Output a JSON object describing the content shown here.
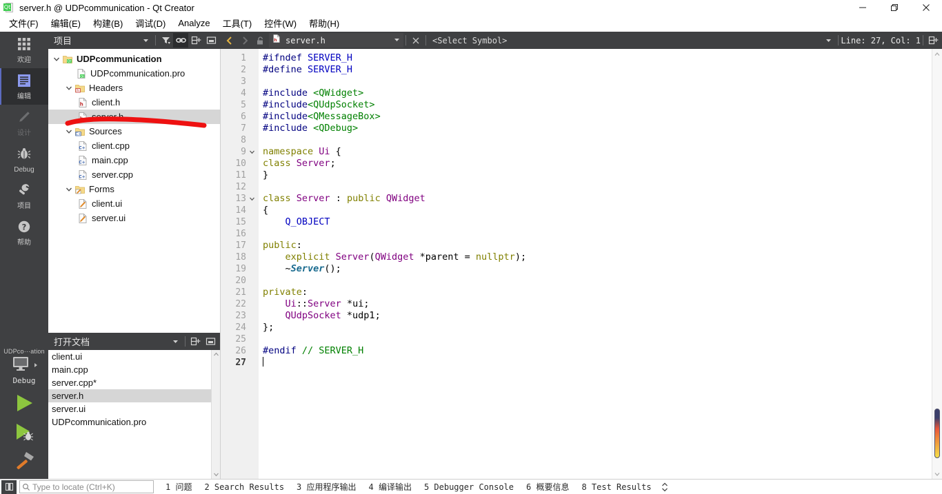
{
  "window": {
    "title": "server.h @ UDPcommunication - Qt Creator",
    "app_icon": "qt-creator-icon",
    "minimize": "minimize-icon",
    "maximize": "restore-icon",
    "close": "close-icon"
  },
  "menubar": {
    "items": [
      {
        "label": "文件(F)",
        "accel": "F"
      },
      {
        "label": "编辑(E)",
        "accel": "E"
      },
      {
        "label": "构建(B)",
        "accel": "B"
      },
      {
        "label": "调试(D)",
        "accel": "D"
      },
      {
        "label": "Analyze",
        "accel": "A"
      },
      {
        "label": "工具(T)",
        "accel": "T"
      },
      {
        "label": "控件(W)",
        "accel": "W"
      },
      {
        "label": "帮助(H)",
        "accel": "H"
      }
    ]
  },
  "modebar": {
    "modes": [
      {
        "label": "欢迎",
        "icon": "grid-icon",
        "state": "normal"
      },
      {
        "label": "编辑",
        "icon": "edit-lines-icon",
        "state": "selected"
      },
      {
        "label": "设计",
        "icon": "pencil-icon",
        "state": "disabled"
      },
      {
        "label": "Debug",
        "icon": "bug-icon",
        "state": "normal"
      },
      {
        "label": "项目",
        "icon": "wrench-icon",
        "state": "normal"
      },
      {
        "label": "帮助",
        "icon": "question-mark-icon",
        "state": "normal"
      }
    ],
    "kit": {
      "project_name": "UDPco···ation",
      "build_config": "Debug",
      "target_icon": "desktop-icon",
      "arrow_icon": "chevron-right-icon"
    },
    "actions": [
      {
        "name": "run-button",
        "icon": "green-play-icon"
      },
      {
        "name": "debug-button",
        "icon": "play-bug-icon"
      },
      {
        "name": "build-button",
        "icon": "hammer-icon"
      }
    ]
  },
  "project_dock": {
    "title": "项目",
    "dropdown_icon": "chevron-down-icon",
    "toolbar": [
      {
        "name": "filter-button",
        "icon": "filter-icon",
        "active": false
      },
      {
        "name": "sync-with-editor-button",
        "icon": "link-icon",
        "active": true
      },
      {
        "name": "split-button",
        "icon": "split-icon",
        "active": false
      },
      {
        "name": "close-split-button",
        "icon": "close-split-icon",
        "active": false
      }
    ],
    "tree": [
      {
        "label": "UDPcommunication",
        "icon": "qt-project-icon",
        "depth": 0,
        "expanded": true,
        "bold": true,
        "selected": false
      },
      {
        "label": "UDPcommunication.pro",
        "icon": "pro-file-icon",
        "depth": 1,
        "expanded": null,
        "bold": false,
        "selected": false
      },
      {
        "label": "Headers",
        "icon": "headers-folder-icon",
        "depth": 1,
        "expanded": true,
        "bold": false,
        "selected": false
      },
      {
        "label": "client.h",
        "icon": "header-file-icon",
        "depth": 2,
        "expanded": null,
        "bold": false,
        "selected": false
      },
      {
        "label": "server.h",
        "icon": "header-file-icon",
        "depth": 2,
        "expanded": null,
        "bold": false,
        "selected": true
      },
      {
        "label": "Sources",
        "icon": "sources-folder-icon",
        "depth": 1,
        "expanded": true,
        "bold": false,
        "selected": false
      },
      {
        "label": "client.cpp",
        "icon": "cpp-file-icon",
        "depth": 2,
        "expanded": null,
        "bold": false,
        "selected": false
      },
      {
        "label": "main.cpp",
        "icon": "cpp-file-icon",
        "depth": 2,
        "expanded": null,
        "bold": false,
        "selected": false
      },
      {
        "label": "server.cpp",
        "icon": "cpp-file-icon",
        "depth": 2,
        "expanded": null,
        "bold": false,
        "selected": false
      },
      {
        "label": "Forms",
        "icon": "forms-folder-icon",
        "depth": 1,
        "expanded": true,
        "bold": false,
        "selected": false
      },
      {
        "label": "client.ui",
        "icon": "ui-file-icon",
        "depth": 2,
        "expanded": null,
        "bold": false,
        "selected": false
      },
      {
        "label": "server.ui",
        "icon": "ui-file-icon",
        "depth": 2,
        "expanded": null,
        "bold": false,
        "selected": false
      }
    ]
  },
  "open_documents": {
    "title": "打开文档",
    "dropdown_icon": "chevron-down-icon",
    "toolbar": [
      {
        "name": "split-button",
        "icon": "split-icon"
      },
      {
        "name": "close-button",
        "icon": "close-split-icon"
      }
    ],
    "items": [
      {
        "label": "client.ui",
        "selected": false
      },
      {
        "label": "main.cpp",
        "selected": false
      },
      {
        "label": "server.cpp*",
        "selected": false
      },
      {
        "label": "server.h",
        "selected": true
      },
      {
        "label": "server.ui",
        "selected": false
      },
      {
        "label": "UDPcommunication.pro",
        "selected": false
      }
    ]
  },
  "editor_toolbar": {
    "back_icon": "chevron-left-icon",
    "forward_icon": "chevron-right-icon",
    "lock_icon": "unlocked-icon",
    "file_icon": "header-file-icon",
    "file_name": "server.h",
    "file_caret": "chevron-down-icon",
    "close_icon": "close-icon",
    "symbol_selector": "<Select Symbol>",
    "symbol_caret": "chevron-down-icon",
    "line_col": "Line: 27, Col: 1",
    "split_icon": "split-icon"
  },
  "code": {
    "language": "cpp",
    "current_line": 27,
    "fold_lines": [
      9,
      13
    ],
    "lines": [
      {
        "n": 1,
        "tokens": [
          {
            "t": "#ifndef ",
            "c": "pp"
          },
          {
            "t": "SERVER_H",
            "c": "macro"
          }
        ]
      },
      {
        "n": 2,
        "tokens": [
          {
            "t": "#define ",
            "c": "pp"
          },
          {
            "t": "SERVER_H",
            "c": "macro"
          }
        ]
      },
      {
        "n": 3,
        "tokens": []
      },
      {
        "n": 4,
        "tokens": [
          {
            "t": "#include ",
            "c": "pp"
          },
          {
            "t": "<QWidget>",
            "c": "inc"
          }
        ]
      },
      {
        "n": 5,
        "tokens": [
          {
            "t": "#include",
            "c": "pp"
          },
          {
            "t": "<QUdpSocket>",
            "c": "inc"
          }
        ]
      },
      {
        "n": 6,
        "tokens": [
          {
            "t": "#include",
            "c": "pp"
          },
          {
            "t": "<QMessageBox>",
            "c": "inc"
          }
        ]
      },
      {
        "n": 7,
        "tokens": [
          {
            "t": "#include ",
            "c": "pp"
          },
          {
            "t": "<QDebug>",
            "c": "inc"
          }
        ]
      },
      {
        "n": 8,
        "tokens": []
      },
      {
        "n": 9,
        "tokens": [
          {
            "t": "namespace ",
            "c": "kw"
          },
          {
            "t": "Ui",
            "c": "type"
          },
          {
            "t": " {",
            "c": "plain"
          }
        ]
      },
      {
        "n": 10,
        "tokens": [
          {
            "t": "class ",
            "c": "kw"
          },
          {
            "t": "Server",
            "c": "type"
          },
          {
            "t": ";",
            "c": "plain"
          }
        ]
      },
      {
        "n": 11,
        "tokens": [
          {
            "t": "}",
            "c": "plain"
          }
        ]
      },
      {
        "n": 12,
        "tokens": []
      },
      {
        "n": 13,
        "tokens": [
          {
            "t": "class ",
            "c": "kw"
          },
          {
            "t": "Server",
            "c": "type"
          },
          {
            "t": " : ",
            "c": "plain"
          },
          {
            "t": "public ",
            "c": "kw"
          },
          {
            "t": "QWidget",
            "c": "type"
          }
        ]
      },
      {
        "n": 14,
        "tokens": [
          {
            "t": "{",
            "c": "plain"
          }
        ]
      },
      {
        "n": 15,
        "tokens": [
          {
            "t": "    ",
            "c": "plain"
          },
          {
            "t": "Q_OBJECT",
            "c": "macro"
          }
        ]
      },
      {
        "n": 16,
        "tokens": []
      },
      {
        "n": 17,
        "tokens": [
          {
            "t": "public",
            "c": "kw"
          },
          {
            "t": ":",
            "c": "plain"
          }
        ]
      },
      {
        "n": 18,
        "tokens": [
          {
            "t": "    ",
            "c": "plain"
          },
          {
            "t": "explicit ",
            "c": "kw"
          },
          {
            "t": "Server",
            "c": "type"
          },
          {
            "t": "(",
            "c": "plain"
          },
          {
            "t": "QWidget",
            "c": "type"
          },
          {
            "t": " *parent = ",
            "c": "plain"
          },
          {
            "t": "nullptr",
            "c": "kw"
          },
          {
            "t": ");",
            "c": "plain"
          }
        ]
      },
      {
        "n": 19,
        "tokens": [
          {
            "t": "    ~",
            "c": "plain"
          },
          {
            "t": "Server",
            "c": "virt"
          },
          {
            "t": "();",
            "c": "plain"
          }
        ]
      },
      {
        "n": 20,
        "tokens": []
      },
      {
        "n": 21,
        "tokens": [
          {
            "t": "private",
            "c": "kw"
          },
          {
            "t": ":",
            "c": "plain"
          }
        ]
      },
      {
        "n": 22,
        "tokens": [
          {
            "t": "    ",
            "c": "plain"
          },
          {
            "t": "Ui",
            "c": "type"
          },
          {
            "t": "::",
            "c": "plain"
          },
          {
            "t": "Server",
            "c": "type"
          },
          {
            "t": " *ui;",
            "c": "plain"
          }
        ]
      },
      {
        "n": 23,
        "tokens": [
          {
            "t": "    ",
            "c": "plain"
          },
          {
            "t": "QUdpSocket",
            "c": "type"
          },
          {
            "t": " *udp1;",
            "c": "plain"
          }
        ]
      },
      {
        "n": 24,
        "tokens": [
          {
            "t": "};",
            "c": "plain"
          }
        ]
      },
      {
        "n": 25,
        "tokens": []
      },
      {
        "n": 26,
        "tokens": [
          {
            "t": "#endif ",
            "c": "pp"
          },
          {
            "t": "// SERVER_H",
            "c": "cmt"
          }
        ]
      },
      {
        "n": 27,
        "tokens": []
      }
    ]
  },
  "scrollbar": {
    "up_icon": "chevron-up-icon",
    "down_icon": "chevron-down-icon",
    "thumb_colors": [
      "#3b3f6b",
      "#e8553b",
      "#f08c3a",
      "#f5e04a"
    ]
  },
  "statusbar": {
    "locator_placeholder": "Type to locate (Ctrl+K)",
    "locator_value": "",
    "search_icon": "search-icon",
    "locator_button_icon": "sidebar-toggle-icon",
    "output_tabs": [
      {
        "num": "1",
        "label": "问题"
      },
      {
        "num": "2",
        "label": "Search Results"
      },
      {
        "num": "3",
        "label": "应用程序输出"
      },
      {
        "num": "4",
        "label": "编译输出"
      },
      {
        "num": "5",
        "label": "Debugger Console"
      },
      {
        "num": "6",
        "label": "概要信息"
      },
      {
        "num": "8",
        "label": "Test Results"
      }
    ],
    "spinner_icon": "up-down-arrows-icon"
  },
  "annotation": {
    "type": "hand-drawn-underline",
    "color": "#ee1111",
    "target": "server.h"
  }
}
